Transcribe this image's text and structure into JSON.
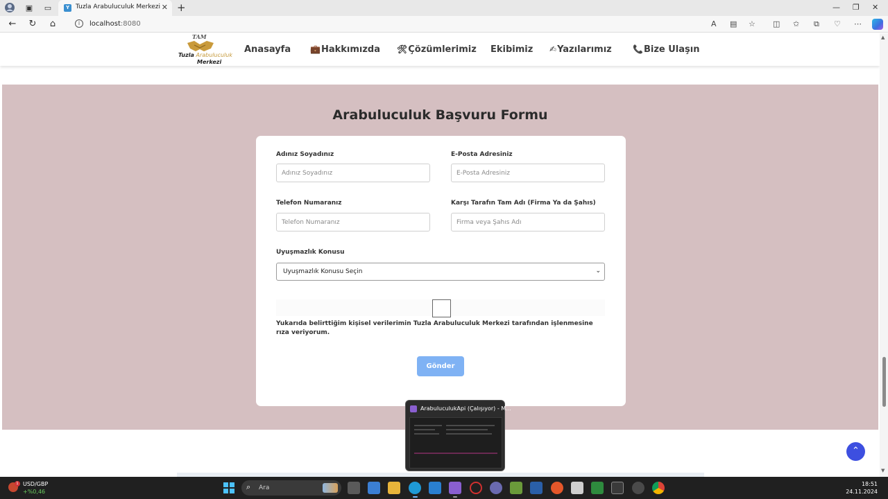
{
  "browser": {
    "tab_title": "Tuzla Arabuluculuk Merkezi",
    "url_host": "localhost",
    "url_port": ":8080"
  },
  "site": {
    "logo": {
      "top": "TAM",
      "line1_bold": "Tuzla",
      "line1_rest": " Arabuluculuk",
      "line2": "Merkezi"
    },
    "nav": [
      {
        "icon": "",
        "label": "Anasayfa"
      },
      {
        "icon": "💼",
        "label": "Hakkımızda"
      },
      {
        "icon": "🛠",
        "label": "Çözümlerimiz"
      },
      {
        "icon": "",
        "label": "Ekibimiz"
      },
      {
        "icon": "✍",
        "label": "Yazılarımız"
      },
      {
        "icon": "📞",
        "label": "Bize Ulaşın"
      }
    ]
  },
  "form": {
    "title": "Arabuluculuk Başvuru Formu",
    "name_label": "Adınız Soyadınız",
    "name_placeholder": "Adınız Soyadınız",
    "email_label": "E-Posta Adresiniz",
    "email_placeholder": "E-Posta Adresiniz",
    "phone_label": "Telefon Numaranız",
    "phone_placeholder": "Telefon Numaranız",
    "party_label": "Karşı Tarafın Tam Adı (Firma Ya da Şahıs)",
    "party_placeholder": "Firma veya Şahıs Adı",
    "dispute_label": "Uyuşmazlık Konusu",
    "dispute_selected": "Uyuşmazlık Konusu Seçin",
    "consent_text": "Yukarıda belirttiğim kişisel verilerimin Tuzla Arabuluculuk Merkezi tarafından işlenmesine rıza veriyorum.",
    "submit_label": "Gönder"
  },
  "taskbar": {
    "preview_title": "ArabuluculukApi (Çalışıyor) - M...",
    "ticker_name": "USD/GBP",
    "ticker_change": "+%0,46",
    "ticker_badge": "1",
    "search_placeholder": "Ara",
    "time": "18:51",
    "date": "24.11.2024"
  },
  "colors": {
    "section_bg": "#d5bfc1",
    "submit_bg": "#7fb2f4",
    "to_top_bg": "#3d4fe0"
  }
}
